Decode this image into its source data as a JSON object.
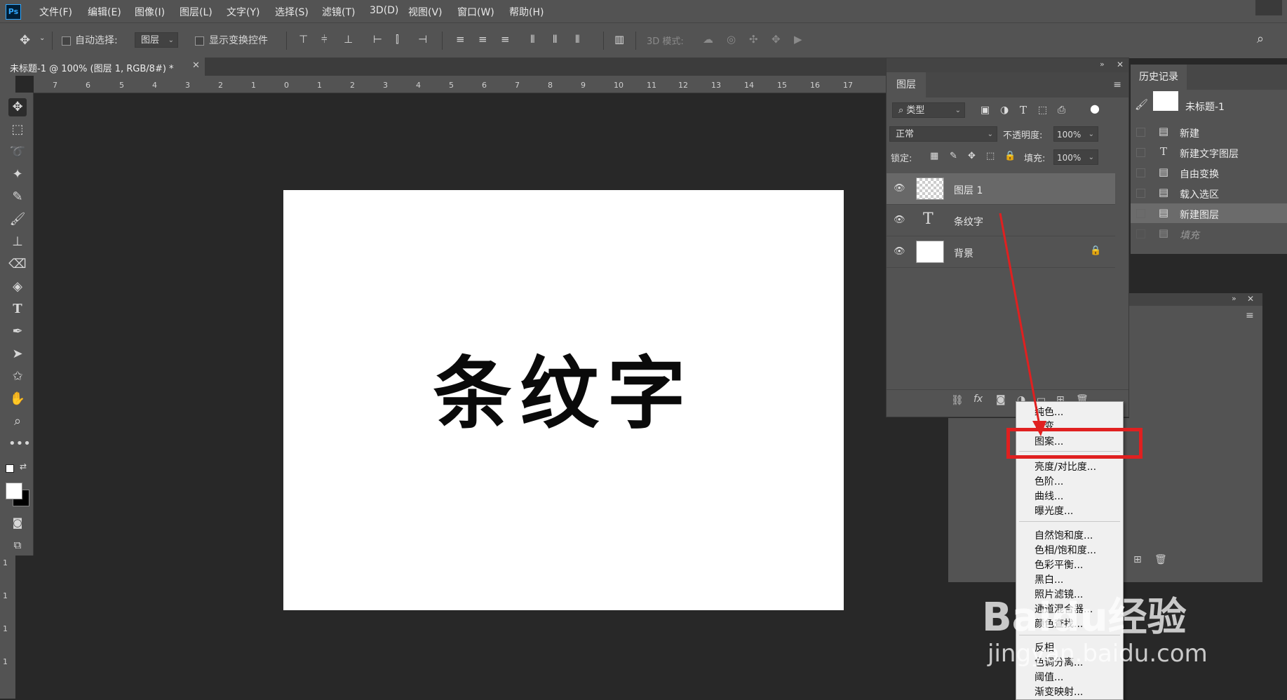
{
  "app": {
    "logo": "Ps"
  },
  "menu": [
    "文件(F)",
    "编辑(E)",
    "图像(I)",
    "图层(L)",
    "文字(Y)",
    "选择(S)",
    "滤镜(T)",
    "3D(D)",
    "视图(V)",
    "窗口(W)",
    "帮助(H)"
  ],
  "options": {
    "auto_select_label": "自动选择:",
    "auto_select_value": "图层",
    "show_transform_label": "显示变换控件",
    "mode_3d_label": "3D 模式:"
  },
  "document": {
    "tab_title": "未标题-1 @ 100% (图层 1, RGB/8#) *",
    "canvas_text": "条纹字"
  },
  "ruler_h": [
    "7",
    "6",
    "5",
    "4",
    "3",
    "2",
    "1",
    "0",
    "1",
    "2",
    "3",
    "4",
    "5",
    "6",
    "7",
    "8",
    "9",
    "10",
    "11",
    "12",
    "13",
    "14",
    "15",
    "16",
    "17"
  ],
  "ruler_v": [
    "1",
    "1",
    "1",
    "1"
  ],
  "layers_panel": {
    "tab": "图层",
    "filter_kind": "类型",
    "blend_mode": "正常",
    "opacity_label": "不透明度:",
    "opacity_value": "100%",
    "lock_label": "锁定:",
    "fill_label": "填充:",
    "fill_value": "100%",
    "layers": [
      {
        "name": "图层 1",
        "type": "pixel",
        "selected": true
      },
      {
        "name": "条纹字",
        "type": "text",
        "selected": false
      },
      {
        "name": "背景",
        "type": "background",
        "selected": false,
        "locked": true
      }
    ],
    "footer_fx": "fx"
  },
  "history_panel": {
    "tab": "历史记录",
    "snapshot": "未标题-1",
    "items": [
      {
        "label": "新建",
        "icon": "doc-icon"
      },
      {
        "label": "新建文字图层",
        "icon": "text-icon"
      },
      {
        "label": "自由变换",
        "icon": "doc-icon"
      },
      {
        "label": "载入选区",
        "icon": "doc-icon"
      },
      {
        "label": "新建图层",
        "icon": "doc-icon",
        "selected": true
      },
      {
        "label": "填充",
        "icon": "doc-icon",
        "dimmed": true
      }
    ]
  },
  "context_menu": {
    "items_top": [
      "纯色...",
      "渐变...",
      "图案..."
    ],
    "items_mid": [
      "亮度/对比度...",
      "色阶...",
      "曲线...",
      "曝光度..."
    ],
    "items_adj": [
      "自然饱和度...",
      "色相/饱和度...",
      "色彩平衡...",
      "黑白...",
      "照片滤镜...",
      "通道混合器...",
      "颜色查找..."
    ],
    "items_bottom": [
      "反相",
      "色调分离...",
      "阈值...",
      "渐变映射..."
    ]
  },
  "watermark": {
    "line1": "Baidu经验",
    "line2": "jingyan.baidu.com"
  },
  "colors": {
    "ui_bg": "#535353",
    "canvas_bg": "#282828",
    "highlight_red": "#e02020"
  }
}
